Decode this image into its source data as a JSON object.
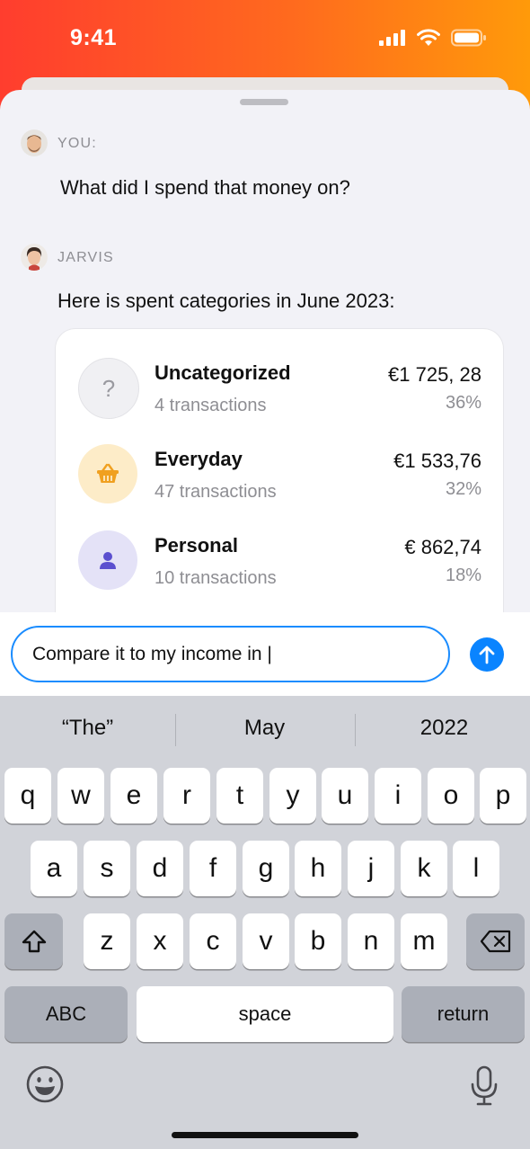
{
  "status_bar": {
    "time": "9:41"
  },
  "chat": {
    "user_sender": "YOU:",
    "user_message": "What did I spend that money on?",
    "bot_sender": "JARVIS",
    "bot_message": "Here is spent categories in June 2023:"
  },
  "categories": [
    {
      "name": "Uncategorized",
      "count": "4 transactions",
      "amount": "€1 725, 28",
      "percent": "36%",
      "icon": "question-icon",
      "icon_text": "?",
      "color": "#f0f0f3"
    },
    {
      "name": "Everyday",
      "count": "47 transactions",
      "amount": "€1 533,76",
      "percent": "32%",
      "icon": "basket-icon",
      "color": "#fdecc8"
    },
    {
      "name": "Personal",
      "count": "10 transactions",
      "amount": "€ 862,74",
      "percent": "18%",
      "icon": "person-icon",
      "color": "#e4e2f7"
    }
  ],
  "input": {
    "value": "Compare it to my income in |"
  },
  "keyboard": {
    "suggestions": [
      "“The”",
      "May",
      "2022"
    ],
    "row1": [
      "q",
      "w",
      "e",
      "r",
      "t",
      "y",
      "u",
      "i",
      "o",
      "p"
    ],
    "row2": [
      "a",
      "s",
      "d",
      "f",
      "g",
      "h",
      "j",
      "k",
      "l"
    ],
    "row3": [
      "z",
      "x",
      "c",
      "v",
      "b",
      "n",
      "m"
    ],
    "abc_label": "ABC",
    "space_label": "space",
    "return_label": "return"
  },
  "colors": {
    "accent": "#0a84ff",
    "gradient_start": "#ff3d2e",
    "gradient_end": "#ff9a0a"
  }
}
